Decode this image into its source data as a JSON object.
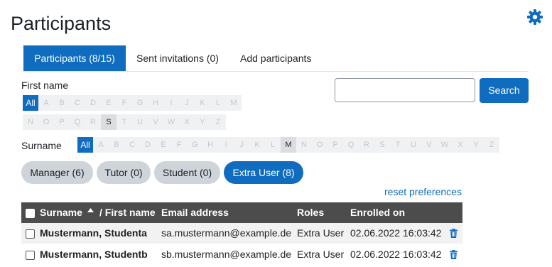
{
  "page": {
    "title": "Participants"
  },
  "icons": {
    "settings": "gear-icon",
    "delete": "trash-icon",
    "sort": "sort-ascending-icon"
  },
  "colors": {
    "primary": "#0f6cbf",
    "header_bg": "#4c4c4c",
    "pill_bg": "#ced4da"
  },
  "tabs": [
    {
      "label": "Participants (8/15)",
      "active": true
    },
    {
      "label": "Sent invitations (0)",
      "active": false
    },
    {
      "label": "Add participants",
      "active": false
    }
  ],
  "filters": {
    "first_name_label": "First name",
    "surname_label": "Surname",
    "all_label": "All",
    "letters": [
      "A",
      "B",
      "C",
      "D",
      "E",
      "F",
      "G",
      "H",
      "I",
      "J",
      "K",
      "L",
      "M",
      "N",
      "O",
      "P",
      "Q",
      "R",
      "S",
      "T",
      "U",
      "V",
      "W",
      "X",
      "Y",
      "Z"
    ],
    "first_name_selected": "S",
    "surname_selected": "M"
  },
  "search": {
    "placeholder": "",
    "value": "",
    "button_label": "Search"
  },
  "roles": [
    {
      "label": "Manager (6)",
      "active": false
    },
    {
      "label": "Tutor (0)",
      "active": false
    },
    {
      "label": "Student (0)",
      "active": false
    },
    {
      "label": "Extra User (8)",
      "active": true
    }
  ],
  "reset_label": "reset preferences",
  "table": {
    "headers": {
      "surname": "Surname",
      "first_name": "/ First name",
      "email": "Email address",
      "roles": "Roles",
      "enrolled": "Enrolled on"
    },
    "rows": [
      {
        "name": "Mustermann, Studenta",
        "email": "sa.mustermann@example.de",
        "role": "Extra User",
        "enrolled": "02.06.2022 16:03:42"
      },
      {
        "name": "Mustermann, Studentb",
        "email": "sb.mustermann@example.de",
        "role": "Extra User",
        "enrolled": "02.06.2022 16:03:42"
      }
    ]
  }
}
